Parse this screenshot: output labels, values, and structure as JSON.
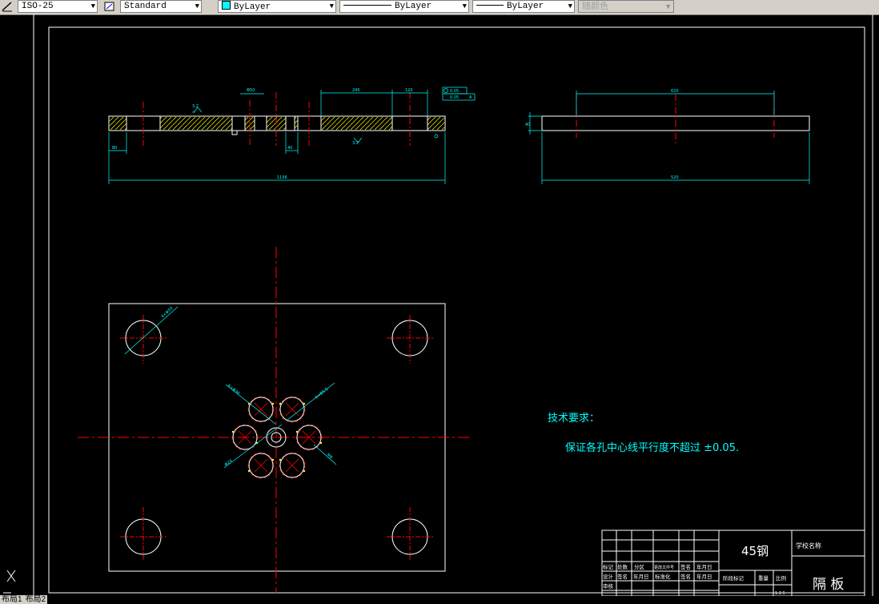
{
  "toolbar": {
    "dimstyle": "ISO-25",
    "textstyle": "Standard",
    "layer_color": "ByLayer",
    "linetype": "ByLayer",
    "lineweight": "ByLayer",
    "plotstyle": "随颜色"
  },
  "layout_tabs": [
    "布局1",
    "布局2"
  ],
  "drawing": {
    "front_view_dims": {
      "overall": "1156",
      "left": "80",
      "mid_left": "40",
      "top_a": "245",
      "top_b": "120",
      "top_c": "Φ50",
      "tol_a": "0.05",
      "tol_b": "0.05",
      "datum": "A",
      "roughness": "3.2",
      "roughness_top": "3.2"
    },
    "side_view_dims": {
      "top": "620",
      "bottom": "520",
      "height": "40"
    },
    "plan_dims": {
      "corner_hole": "4×Φ50",
      "group_a": "6×Φ36",
      "group_b": "6×Φ5.5",
      "group_c": "M8",
      "center": "Φ24"
    },
    "tech_heading": "技术要求：",
    "tech_note": "保证各孔中心线平行度不超过 ±0.05."
  },
  "title_block": {
    "material": "45钢",
    "school": "学校名称",
    "part_name": "隔 板",
    "row1": [
      "标记",
      "处数",
      "分区",
      "更改文件号",
      "签名",
      "年月日"
    ],
    "row2": [
      "设计",
      "签名",
      "年月日",
      "标准化",
      "签名",
      "年月日"
    ],
    "row3": [
      "审核"
    ],
    "stage_label": "阶段标记",
    "weight_label": "重量",
    "scale_label": "比例",
    "scale_value": "1:2.5"
  },
  "colors": {
    "line_white": "#ffffff",
    "centerline_red": "#ff0000",
    "dimension_cyan": "#00ffff",
    "hatch_yellow": "#ffff00",
    "accent_magenta": "#ff00ff"
  }
}
